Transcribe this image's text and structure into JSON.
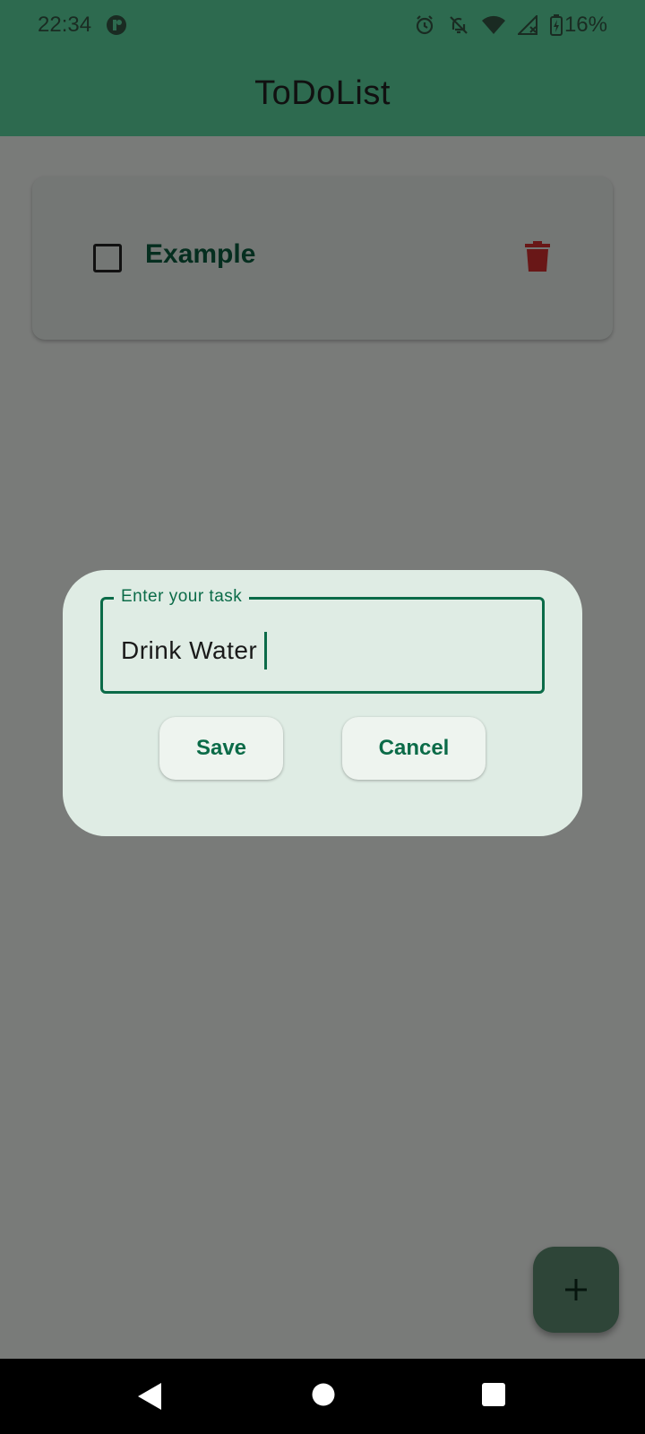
{
  "status_bar": {
    "time": "22:34",
    "battery": "16%"
  },
  "app_bar": {
    "title": "ToDoList"
  },
  "tasks": [
    {
      "label": "Example",
      "checked": false
    }
  ],
  "dialog": {
    "field_label": "Enter your task",
    "field_value": "Drink Water",
    "save_label": "Save",
    "cancel_label": "Cancel"
  },
  "colors": {
    "primary": "#2d6a4f",
    "accent": "#0b6b48",
    "delete": "#d32f2f",
    "dialog_bg": "#dfece4"
  },
  "icons": {
    "status_app": "app-notification-icon",
    "alarm": "alarm-icon",
    "mute": "bell-off-icon",
    "wifi": "wifi-icon",
    "signal": "signal-icon",
    "battery": "battery-charging-icon",
    "delete": "trash-icon",
    "fab": "plus-icon",
    "nav_back": "back-icon",
    "nav_home": "home-icon",
    "nav_recent": "recents-icon"
  }
}
